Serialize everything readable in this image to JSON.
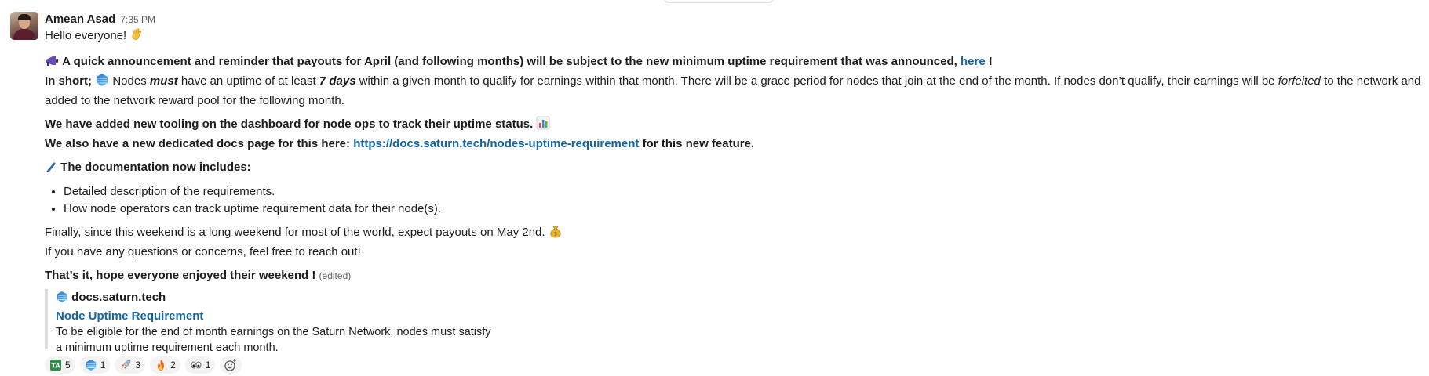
{
  "message": {
    "author": "Amean Asad",
    "time": "7:35 PM",
    "greeting": "Hello everyone!",
    "announce_text": "A quick announcement and reminder that payouts for April (and following months) will be subject to the new minimum uptime requirement that was announced,",
    "announce_link": "here",
    "announce_end": "!",
    "short_prefix": "In short;",
    "short_nodes": "Nodes",
    "short_must": "must",
    "short_mid": "have an uptime of at least",
    "short_days": "7 days",
    "short_rest": "within a given month to qualify for earnings within that month. There will be a grace period for nodes that join at the end of the month. If nodes don’t qualify, their earnings will be",
    "short_forfeited": "forfeited",
    "short_end": "to the network and",
    "short_line2": "added to the network reward pool for the following month.",
    "tooling_line": "We have added new tooling on the dashboard for node ops to track their uptime status.",
    "docs_prefix": "We also have a new dedicated docs page for this here:",
    "docs_url": "https://docs.saturn.tech/nodes-uptime-requirement",
    "docs_suffix": "for this new feature.",
    "includes_heading": "The documentation now includes:",
    "bullets": [
      "Detailed description of the requirements.",
      "How node operators can track uptime requirement data for their node(s)."
    ],
    "finally_line": "Finally, since this weekend is a long weekend for most of the world, expect payouts on May 2nd.",
    "questions_line": "If you have any questions or concerns, feel free to reach out!",
    "closing_line": "That’s it, hope everyone enjoyed their weekend !",
    "edited_label": "(edited)"
  },
  "attachment": {
    "site": "docs.saturn.tech",
    "title": "Node Uptime Requirement",
    "desc_line1": "To be eligible for the end of month earnings on the Saturn Network, nodes must satisfy",
    "desc_line2": "a minimum uptime requirement each month."
  },
  "reactions": [
    {
      "icon": "tada-icon",
      "count": "5"
    },
    {
      "icon": "saturn-logo-icon",
      "count": "1"
    },
    {
      "icon": "rocket-icon",
      "count": "3"
    },
    {
      "icon": "fire-icon",
      "count": "2"
    },
    {
      "icon": "eyes-icon",
      "count": "1"
    }
  ],
  "colors": {
    "link": "#1264a3",
    "text": "#1d1c1d",
    "muted": "#616061",
    "reaction_bg": "#f3f3f3"
  }
}
